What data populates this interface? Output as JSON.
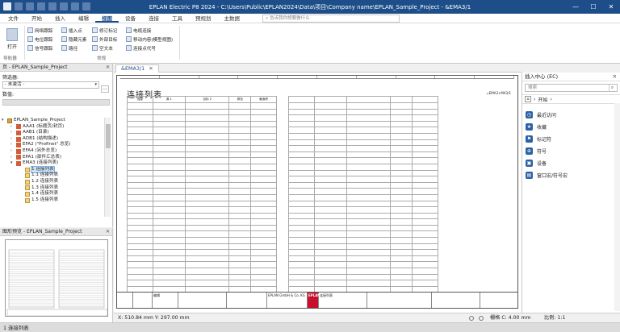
{
  "titlebar": {
    "title": "EPLAN Electric P8 2024 - C:\\Users\\Public\\EPLAN2024\\Data\\项目\\Company name\\EPLAN_Sample_Project - &EMA3/1",
    "min": "—",
    "max": "☐",
    "close": "✕"
  },
  "menu": {
    "items": [
      "文件",
      "开始",
      "插入",
      "编辑",
      "视图",
      "设备",
      "连接",
      "工具",
      "预规划",
      "主数据"
    ],
    "search_placeholder": "告诉我你想要做什么",
    "search_icon": "⌕"
  },
  "ribbon": {
    "open_label": "打开",
    "navigator_group": "导航器",
    "col1": [
      "网络跟踪",
      "电位跟踪",
      "信号跟踪"
    ],
    "col2": [
      "插入点",
      "隐藏元素",
      "路径"
    ],
    "col3": [
      "修订标记",
      "外部目标",
      "空文本"
    ],
    "col4": [
      "电缆连接",
      "移动内容(模型视图)",
      "连接点代号"
    ],
    "display_group": "常规"
  },
  "leftpane": {
    "title": "页 - EPLAN_Sample_Project",
    "filter_label": "筛选器:",
    "filter_value": "- 未激活 -",
    "dots": "...",
    "value_label": "数值:",
    "tree": [
      {
        "label": "EPLAN_Sample_Project",
        "level": 0,
        "icon": "proj",
        "toggle": "▾"
      },
      {
        "label": "AAA1 (标题页/封页)",
        "level": 1,
        "icon": "red",
        "toggle": "›"
      },
      {
        "label": "AAB1 (目录)",
        "level": 1,
        "icon": "red",
        "toggle": "›"
      },
      {
        "label": "ADB1 (结构描述)",
        "level": 1,
        "icon": "red",
        "toggle": "›"
      },
      {
        "label": "EFA2 (\"Profinet\" 总览)",
        "level": 1,
        "icon": "red",
        "toggle": "›"
      },
      {
        "label": "EFA4 (另外总览)",
        "level": 1,
        "icon": "red",
        "toggle": "›"
      },
      {
        "label": "EPA1 (部件汇总表)",
        "level": 1,
        "icon": "red",
        "toggle": "›"
      },
      {
        "label": "EMA3 (连接列表)",
        "level": 1,
        "icon": "red",
        "toggle": "▾"
      },
      {
        "label": "1 连接列表",
        "level": 2,
        "icon": "fold",
        "toggle": "",
        "selected": true
      },
      {
        "label": "1.1 连接列表",
        "level": 2,
        "icon": "fold",
        "toggle": ""
      },
      {
        "label": "1.2 连接列表",
        "level": 2,
        "icon": "fold",
        "toggle": ""
      },
      {
        "label": "1.3 连接列表",
        "level": 2,
        "icon": "fold",
        "toggle": ""
      },
      {
        "label": "1.4 连接列表",
        "level": 2,
        "icon": "fold",
        "toggle": ""
      },
      {
        "label": "1.5 连接列表",
        "level": 2,
        "icon": "fold",
        "toggle": ""
      }
    ],
    "tabs": [
      "树",
      "列表"
    ]
  },
  "preview": {
    "title": "图形预览 - EPLAN_Sample_Project"
  },
  "document": {
    "tab_label": "&EMA3/1",
    "close": "✕",
    "sheet_title": "连接列表",
    "sheet_ref": "=EMA3+MA3/1",
    "headers": [
      "连接",
      "源 1",
      "目标 2",
      "颜色",
      "截面积"
    ],
    "titleblock": {
      "editor": "编辑",
      "company": "EPLAN GmbH & Co. KG",
      "logo": "EPLAN",
      "doc": "连接列表"
    }
  },
  "rightpane": {
    "title": "插入中心 (EC)",
    "search_placeholder": "搜索",
    "nav_label": "开始",
    "items": [
      "最近访问",
      "收藏",
      "标记符",
      "符号",
      "设备",
      "窗口宏/符号宏"
    ]
  },
  "status": {
    "coords": "X: 510.84 mm Y: 297.00 mm",
    "grid": "栅格 C: 4.00 mm",
    "scale": "比例: 1:1",
    "statusbar": "1 连接列表"
  }
}
